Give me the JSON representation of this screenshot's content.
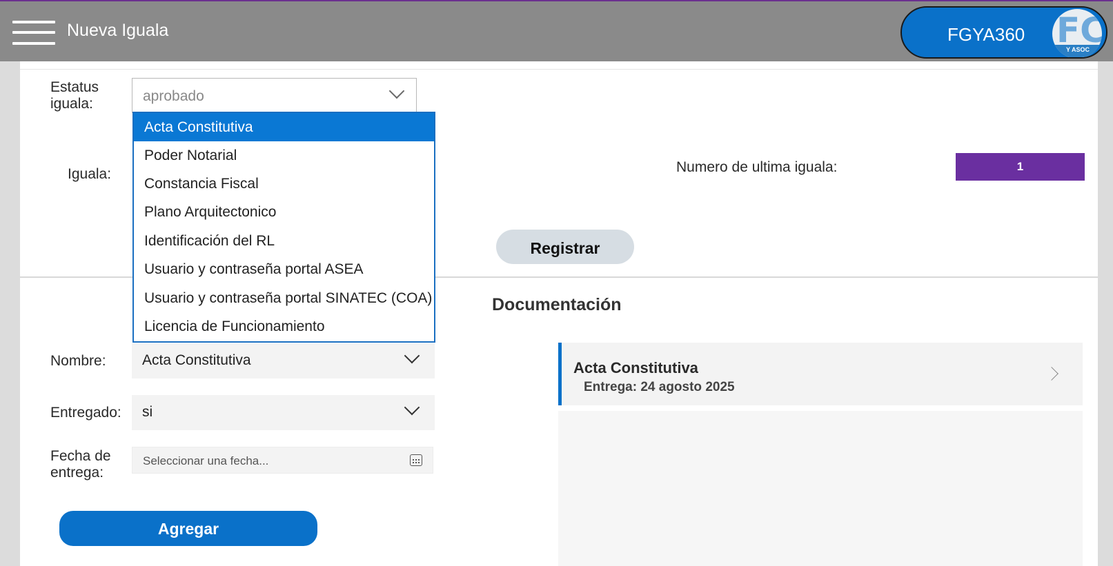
{
  "header": {
    "title": "Nueva Iguala",
    "user_name": "FGYA360",
    "logo_text": "Y ASOC"
  },
  "form": {
    "estatus_label": "Estatus iguala:",
    "estatus_value": "aprobado",
    "iguala_label": "Iguala:",
    "ultima_label": "Numero de ultima iguala:",
    "ultima_value": "1",
    "registrar_label": "Registrar"
  },
  "dropdown": {
    "options": [
      "Acta Constitutiva",
      "Poder Notarial",
      "Constancia Fiscal",
      "Plano Arquitectonico",
      "Identificación del RL",
      "Usuario y contraseña portal ASEA",
      "Usuario y contraseña portal SINATEC (COA)",
      "Licencia de Funcionamiento"
    ],
    "selected": "Acta Constitutiva"
  },
  "documento_form": {
    "nombre_label": "Nombre:",
    "nombre_value": "Acta Constitutiva",
    "entregado_label": "Entregado:",
    "entregado_value": "si",
    "fecha_label": "Fecha de entrega:",
    "fecha_placeholder": "Seleccionar una fecha...",
    "agregar_label": "Agregar"
  },
  "documentacion": {
    "heading": "Documentación",
    "items": [
      {
        "title": "Acta Constitutiva",
        "subtitle": "Entrega: 24 agosto 2025"
      }
    ]
  },
  "colors": {
    "topbar": "#8a8a8a",
    "accent_blue": "#0a71c9",
    "badge_purple": "#6a2fa0",
    "dropdown_selected": "#0a78d4"
  }
}
